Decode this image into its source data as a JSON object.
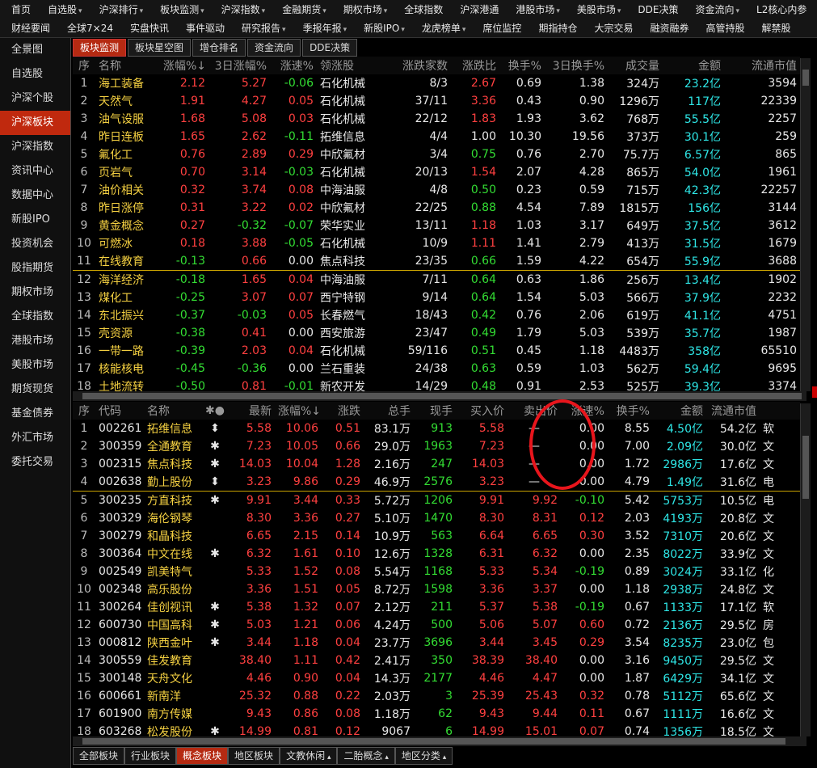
{
  "menu": {
    "row1": [
      {
        "label": "首页",
        "arrow": false
      },
      {
        "label": "自选股",
        "arrow": true
      },
      {
        "label": "沪深排行",
        "arrow": true
      },
      {
        "label": "板块监测",
        "arrow": true
      },
      {
        "label": "沪深指数",
        "arrow": true
      },
      {
        "label": "金融期货",
        "arrow": true
      },
      {
        "label": "期权市场",
        "arrow": true
      },
      {
        "label": "全球指数",
        "arrow": false
      },
      {
        "label": "沪深港通",
        "arrow": false
      },
      {
        "label": "港股市场",
        "arrow": true
      },
      {
        "label": "美股市场",
        "arrow": true
      },
      {
        "label": "DDE决策",
        "arrow": false
      },
      {
        "label": "资金流向",
        "arrow": true
      },
      {
        "label": "L2核心内参",
        "arrow": false
      }
    ],
    "row2": [
      {
        "label": "财经要闻",
        "arrow": false
      },
      {
        "label": "全球7×24",
        "arrow": false
      },
      {
        "label": "实盘快讯",
        "arrow": false
      },
      {
        "label": "事件驱动",
        "arrow": false
      },
      {
        "label": "研究报告",
        "arrow": true
      },
      {
        "label": "季报年报",
        "arrow": true
      },
      {
        "label": "新股IPO",
        "arrow": true
      },
      {
        "label": "龙虎榜单",
        "arrow": true
      },
      {
        "label": "席位监控",
        "arrow": false
      },
      {
        "label": "期指持仓",
        "arrow": false
      },
      {
        "label": "大宗交易",
        "arrow": false
      },
      {
        "label": "融资融券",
        "arrow": false
      },
      {
        "label": "高管持股",
        "arrow": false
      },
      {
        "label": "解禁股",
        "arrow": false
      }
    ]
  },
  "sidebar": [
    "全景图",
    "自选股",
    "沪深个股",
    "沪深板块",
    "沪深指数",
    "资讯中心",
    "数据中心",
    "新股IPO",
    "投资机会",
    "股指期货",
    "期权市场",
    "全球指数",
    "港股市场",
    "美股市场",
    "期货现货",
    "基金债券",
    "外汇市场",
    "委托交易"
  ],
  "sidebar_active": 3,
  "top_tabs": [
    "板块监测",
    "板块星空图",
    "增仓排名",
    "资金流向",
    "DDE决策"
  ],
  "top_tabs_active": 0,
  "upper": {
    "headers": [
      "序",
      "名称",
      "涨幅%↓",
      "3日涨幅%",
      "涨速%",
      "领涨股",
      "涨跌家数",
      "涨跌比",
      "换手%",
      "3日换手%",
      "成交量",
      "金额",
      "流通市值"
    ],
    "rows": [
      [
        "1",
        "海工装备",
        "2.12",
        "5.27",
        "-0.06",
        "石化机械",
        "8/3",
        "2.67",
        "0.69",
        "1.38",
        "324万",
        "23.2亿",
        "3594"
      ],
      [
        "2",
        "天然气",
        "1.91",
        "4.27",
        "0.05",
        "石化机械",
        "37/11",
        "3.36",
        "0.43",
        "0.90",
        "1296万",
        "117亿",
        "22339"
      ],
      [
        "3",
        "油气设服",
        "1.68",
        "5.08",
        "0.03",
        "石化机械",
        "22/12",
        "1.83",
        "1.93",
        "3.62",
        "768万",
        "55.5亿",
        "2257"
      ],
      [
        "4",
        "昨日连板",
        "1.65",
        "2.62",
        "-0.11",
        "拓维信息",
        "4/4",
        "1.00",
        "10.30",
        "19.56",
        "373万",
        "30.1亿",
        "259"
      ],
      [
        "5",
        "氟化工",
        "0.76",
        "2.89",
        "0.29",
        "中欣氟材",
        "3/4",
        "0.75",
        "0.76",
        "2.70",
        "75.7万",
        "6.57亿",
        "865"
      ],
      [
        "6",
        "页岩气",
        "0.70",
        "3.14",
        "-0.03",
        "石化机械",
        "20/13",
        "1.54",
        "2.07",
        "4.28",
        "865万",
        "54.0亿",
        "1961"
      ],
      [
        "7",
        "油价相关",
        "0.32",
        "3.74",
        "0.08",
        "中海油服",
        "4/8",
        "0.50",
        "0.23",
        "0.59",
        "715万",
        "42.3亿",
        "22257"
      ],
      [
        "8",
        "昨日涨停",
        "0.31",
        "3.22",
        "0.02",
        "中欣氟材",
        "22/25",
        "0.88",
        "4.54",
        "7.89",
        "1815万",
        "156亿",
        "3144"
      ],
      [
        "9",
        "黄金概念",
        "0.27",
        "-0.32",
        "-0.07",
        "荣华实业",
        "13/11",
        "1.18",
        "1.03",
        "3.17",
        "649万",
        "37.5亿",
        "3612"
      ],
      [
        "10",
        "可燃冰",
        "0.18",
        "3.88",
        "-0.05",
        "石化机械",
        "10/9",
        "1.11",
        "1.41",
        "2.79",
        "413万",
        "31.5亿",
        "1679"
      ],
      [
        "11",
        "在线教育",
        "-0.13",
        "0.66",
        "0.00",
        "焦点科技",
        "23/35",
        "0.66",
        "1.59",
        "4.22",
        "654万",
        "55.9亿",
        "3688"
      ],
      [
        "12",
        "海洋经济",
        "-0.18",
        "1.65",
        "0.04",
        "中海油服",
        "7/11",
        "0.64",
        "0.63",
        "1.86",
        "256万",
        "13.4亿",
        "1902"
      ],
      [
        "13",
        "煤化工",
        "-0.25",
        "3.07",
        "0.07",
        "西宁特钢",
        "9/14",
        "0.64",
        "1.54",
        "5.03",
        "566万",
        "37.9亿",
        "2232"
      ],
      [
        "14",
        "东北振兴",
        "-0.37",
        "-0.03",
        "0.05",
        "长春燃气",
        "18/43",
        "0.42",
        "0.76",
        "2.06",
        "619万",
        "41.1亿",
        "4751"
      ],
      [
        "15",
        "壳资源",
        "-0.38",
        "0.41",
        "0.00",
        "西安旅游",
        "23/47",
        "0.49",
        "1.79",
        "5.03",
        "539万",
        "35.7亿",
        "1987"
      ],
      [
        "16",
        "一带一路",
        "-0.39",
        "2.03",
        "0.04",
        "石化机械",
        "59/116",
        "0.51",
        "0.45",
        "1.18",
        "4483万",
        "358亿",
        "65510"
      ],
      [
        "17",
        "核能核电",
        "-0.45",
        "-0.36",
        "0.00",
        "兰石重装",
        "24/38",
        "0.63",
        "0.59",
        "1.03",
        "562万",
        "59.4亿",
        "9695"
      ],
      [
        "18",
        "土地流转",
        "-0.50",
        "0.81",
        "-0.01",
        "新农开发",
        "14/29",
        "0.48",
        "0.91",
        "2.53",
        "525万",
        "39.3亿",
        "3374"
      ]
    ]
  },
  "lower": {
    "headers": [
      "序",
      "代码",
      "名称",
      "✱●",
      "最新",
      "涨幅%↓",
      "涨跌",
      "总手",
      "现手",
      "买入价",
      "卖出价",
      "涨速%",
      "换手%",
      "金额",
      "流通市值",
      ""
    ],
    "rows": [
      [
        "1",
        "002261",
        "拓维信息",
        "⬍",
        "5.58",
        "10.06",
        "0.51",
        "83.1万",
        "913",
        "5.58",
        "—",
        "0.00",
        "8.55",
        "4.50亿",
        "54.2亿",
        "软"
      ],
      [
        "2",
        "300359",
        "全通教育",
        "✱",
        "7.23",
        "10.05",
        "0.66",
        "29.0万",
        "1963",
        "7.23",
        "—",
        "0.00",
        "7.00",
        "2.09亿",
        "30.0亿",
        "文"
      ],
      [
        "3",
        "002315",
        "焦点科技",
        "✱",
        "14.03",
        "10.04",
        "1.28",
        "2.16万",
        "247",
        "14.03",
        "—",
        "0.00",
        "1.72",
        "2986万",
        "17.6亿",
        "文"
      ],
      [
        "4",
        "002638",
        "勤上股份",
        "⬍",
        "3.23",
        "9.86",
        "0.29",
        "46.9万",
        "2576",
        "3.23",
        "—",
        "0.00",
        "4.79",
        "1.49亿",
        "31.6亿",
        "电"
      ],
      [
        "5",
        "300235",
        "方直科技",
        "✱",
        "9.91",
        "3.44",
        "0.33",
        "5.72万",
        "1206",
        "9.91",
        "9.92",
        "-0.10",
        "5.42",
        "5753万",
        "10.5亿",
        "电"
      ],
      [
        "6",
        "300329",
        "海伦钢琴",
        "",
        "8.30",
        "3.36",
        "0.27",
        "5.10万",
        "1470",
        "8.30",
        "8.31",
        "0.12",
        "2.03",
        "4193万",
        "20.8亿",
        "文"
      ],
      [
        "7",
        "300279",
        "和晶科技",
        "",
        "6.65",
        "2.15",
        "0.14",
        "10.9万",
        "563",
        "6.64",
        "6.65",
        "0.30",
        "3.52",
        "7310万",
        "20.6亿",
        "文"
      ],
      [
        "8",
        "300364",
        "中文在线",
        "✱",
        "6.32",
        "1.61",
        "0.10",
        "12.6万",
        "1328",
        "6.31",
        "6.32",
        "0.00",
        "2.35",
        "8022万",
        "33.9亿",
        "文"
      ],
      [
        "9",
        "002549",
        "凯美特气",
        "",
        "5.33",
        "1.52",
        "0.08",
        "5.54万",
        "1168",
        "5.33",
        "5.34",
        "-0.19",
        "0.89",
        "3024万",
        "33.1亿",
        "化"
      ],
      [
        "10",
        "002348",
        "高乐股份",
        "",
        "3.36",
        "1.51",
        "0.05",
        "8.72万",
        "1598",
        "3.36",
        "3.37",
        "0.00",
        "1.18",
        "2938万",
        "24.8亿",
        "文"
      ],
      [
        "11",
        "300264",
        "佳创视讯",
        "✱",
        "5.38",
        "1.32",
        "0.07",
        "2.12万",
        "211",
        "5.37",
        "5.38",
        "-0.19",
        "0.67",
        "1133万",
        "17.1亿",
        "软"
      ],
      [
        "12",
        "600730",
        "中国高科",
        "✱",
        "5.03",
        "1.21",
        "0.06",
        "4.24万",
        "500",
        "5.06",
        "5.07",
        "0.60",
        "0.72",
        "2136万",
        "29.5亿",
        "房"
      ],
      [
        "13",
        "000812",
        "陕西金叶",
        "✱",
        "3.44",
        "1.18",
        "0.04",
        "23.7万",
        "3696",
        "3.44",
        "3.45",
        "0.29",
        "3.54",
        "8235万",
        "23.0亿",
        "包"
      ],
      [
        "14",
        "300559",
        "佳发教育",
        "",
        "38.40",
        "1.11",
        "0.42",
        "2.41万",
        "350",
        "38.39",
        "38.40",
        "0.00",
        "3.16",
        "9450万",
        "29.5亿",
        "文"
      ],
      [
        "15",
        "300148",
        "天舟文化",
        "",
        "4.46",
        "0.90",
        "0.04",
        "14.3万",
        "2177",
        "4.46",
        "4.47",
        "0.00",
        "1.87",
        "6429万",
        "34.1亿",
        "文"
      ],
      [
        "16",
        "600661",
        "新南洋",
        "",
        "25.32",
        "0.88",
        "0.22",
        "2.03万",
        "3",
        "25.39",
        "25.43",
        "0.32",
        "0.78",
        "5112万",
        "65.6亿",
        "文"
      ],
      [
        "17",
        "601900",
        "南方传媒",
        "",
        "9.43",
        "0.86",
        "0.08",
        "1.18万",
        "62",
        "9.43",
        "9.44",
        "0.11",
        "0.67",
        "1111万",
        "16.6亿",
        "文"
      ],
      [
        "18",
        "603268",
        "松发股份",
        "✱",
        "14.99",
        "0.81",
        "0.12",
        "9067",
        "6",
        "14.99",
        "15.01",
        "0.07",
        "0.74",
        "1356万",
        "18.5亿",
        "文"
      ]
    ]
  },
  "bottom_tabs": [
    {
      "label": "全部板块",
      "arrow": false
    },
    {
      "label": "行业板块",
      "arrow": false
    },
    {
      "label": "概念板块",
      "arrow": false
    },
    {
      "label": "地区板块",
      "arrow": false
    },
    {
      "label": "文教休闲",
      "arrow": true
    },
    {
      "label": "二胎概念",
      "arrow": true
    },
    {
      "label": "地区分类",
      "arrow": true
    }
  ],
  "bottom_tabs_active": 2,
  "colors": {
    "up": "#ff4040",
    "down": "#33dd33",
    "amount": "#2ee6e6",
    "accent": "#c0290e",
    "separator": "#c9a200",
    "annotation": "#e8151c"
  }
}
